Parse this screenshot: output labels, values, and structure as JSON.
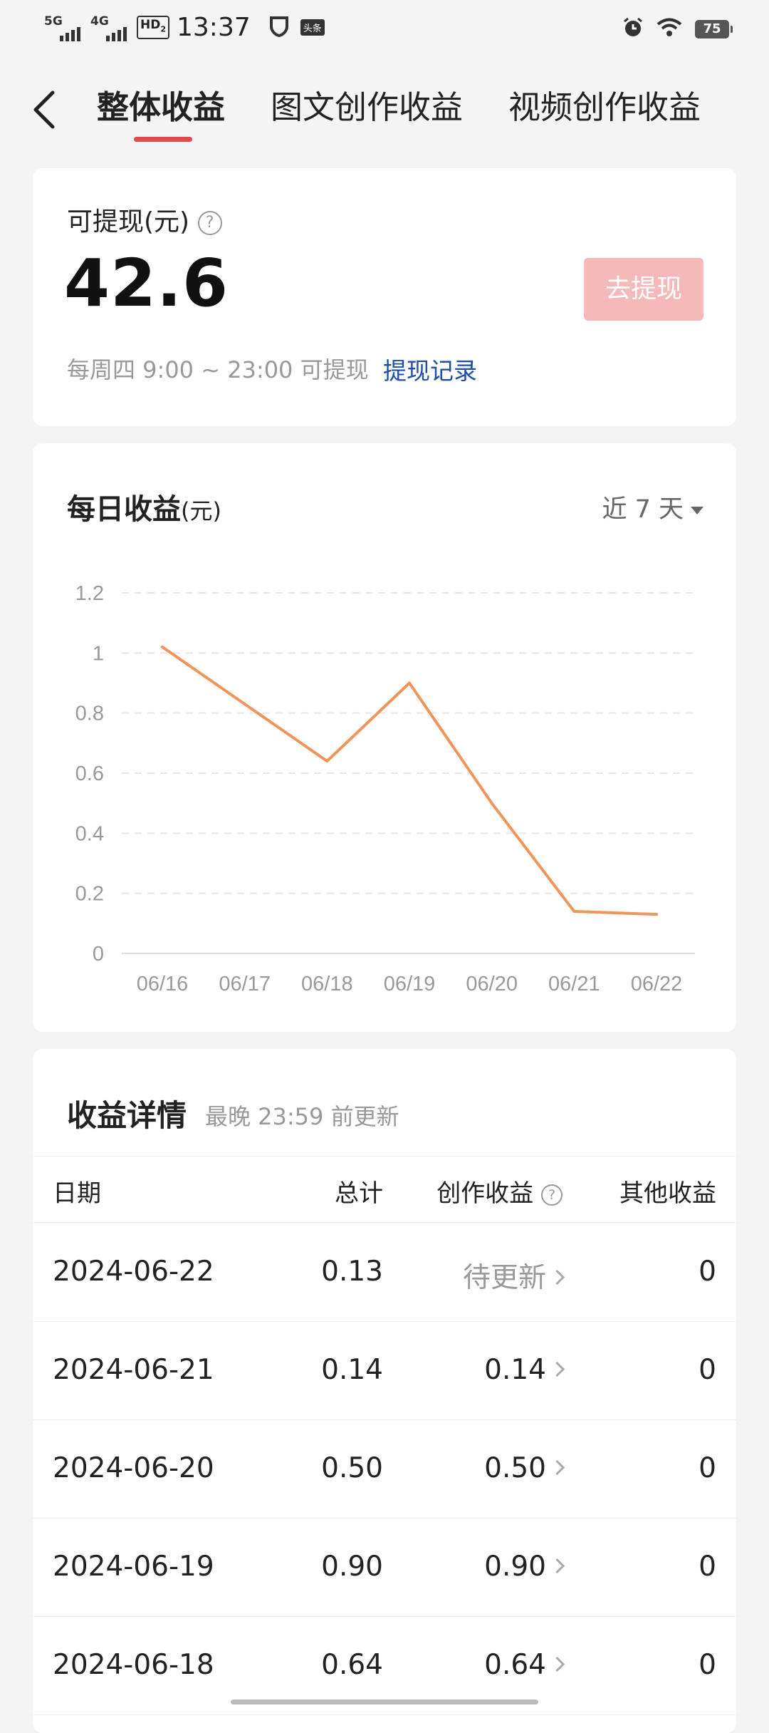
{
  "status_bar": {
    "signal1": "5G",
    "signal2": "4G",
    "hd": "HD",
    "hd_sub": "2",
    "time": "13:37",
    "app_badge": "头条",
    "battery": "75"
  },
  "tabs": [
    {
      "label": "整体收益",
      "active": true
    },
    {
      "label": "图文创作收益",
      "active": false
    },
    {
      "label": "视频创作收益",
      "active": false
    }
  ],
  "withdraw": {
    "label": "可提现(元)",
    "amount": "42.6",
    "button": "去提现",
    "note": "每周四 9:00 ~ 23:00 可提现",
    "record_link": "提现记录"
  },
  "daily": {
    "title": "每日收益",
    "unit": "(元)",
    "range_label": "近 7 天"
  },
  "chart_data": {
    "type": "line",
    "title": "每日收益(元)",
    "x": [
      "06/16",
      "06/17",
      "06/18",
      "06/19",
      "06/20",
      "06/21",
      "06/22"
    ],
    "series": [
      {
        "values": [
          1.02,
          0.83,
          0.64,
          0.9,
          0.5,
          0.14,
          0.13
        ]
      }
    ],
    "ylim": [
      0,
      1.2
    ],
    "yticks": [
      "0",
      "0.2",
      "0.4",
      "0.6",
      "0.8",
      "1",
      "1.2"
    ],
    "grid": true,
    "line_color": "#f0955a"
  },
  "details": {
    "title": "收益详情",
    "subtitle": "最晚 23:59 前更新",
    "headers": {
      "date": "日期",
      "total": "总计",
      "create": "创作收益",
      "other": "其他收益"
    },
    "rows": [
      {
        "date": "2024-06-22",
        "total": "0.13",
        "create": "待更新",
        "other": "0"
      },
      {
        "date": "2024-06-21",
        "total": "0.14",
        "create": "0.14",
        "other": "0"
      },
      {
        "date": "2024-06-20",
        "total": "0.50",
        "create": "0.50",
        "other": "0"
      },
      {
        "date": "2024-06-19",
        "total": "0.90",
        "create": "0.90",
        "other": "0"
      },
      {
        "date": "2024-06-18",
        "total": "0.64",
        "create": "0.64",
        "other": "0"
      }
    ]
  }
}
